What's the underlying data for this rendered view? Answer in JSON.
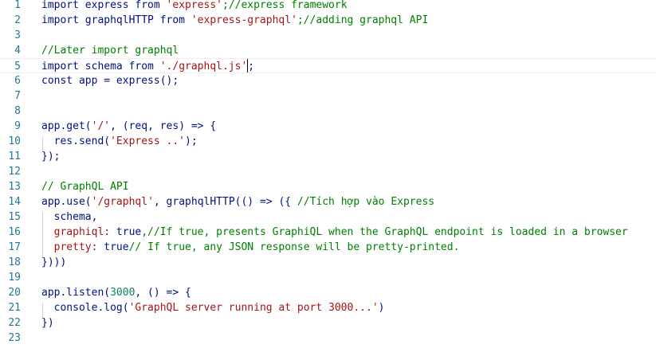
{
  "colors": {
    "keyword": "#0000ff",
    "identifier": "#001080",
    "string": "#a31515",
    "comment": "#008000",
    "number": "#098658",
    "line_number": "#237893",
    "function": "#795e26"
  },
  "editor": {
    "line_numbers": [
      "1",
      "2",
      "3",
      "4",
      "5",
      "6",
      "7",
      "8",
      "9",
      "10",
      "11",
      "12",
      "13",
      "14",
      "15",
      "16",
      "17",
      "18",
      "19",
      "20",
      "21",
      "22",
      "23"
    ],
    "lines": [
      [
        {
          "t": "import express from ",
          "c": "keyword"
        },
        {
          "t": "'express'",
          "c": "string"
        },
        {
          "t": ";//express framework",
          "c": "comment"
        }
      ],
      [
        {
          "t": "import graphqlHTTP from ",
          "c": "keyword"
        },
        {
          "t": "'express-graphql'",
          "c": "string"
        },
        {
          "t": ";//adding graphql API",
          "c": "comment"
        }
      ],
      [],
      [
        {
          "t": "//Later import graphql",
          "c": "comment"
        }
      ],
      [
        {
          "t": "import schema from ",
          "c": "keyword"
        },
        {
          "t": "'./graphql.js'",
          "c": "string"
        },
        {
          "t": "|",
          "c": "cursor"
        },
        {
          "t": ";",
          "c": "keyword"
        }
      ],
      [
        {
          "t": "const app = express();",
          "c": "keyword"
        }
      ],
      [],
      [],
      [
        {
          "t": "app.get(",
          "c": "keyword"
        },
        {
          "t": "'/'",
          "c": "string"
        },
        {
          "t": ", (req, res) => {",
          "c": "keyword"
        }
      ],
      [
        {
          "t": "  res.send(",
          "c": "keyword"
        },
        {
          "t": "'Express ..'",
          "c": "string"
        },
        {
          "t": ");",
          "c": "keyword"
        }
      ],
      [
        {
          "t": "});",
          "c": "keyword"
        }
      ],
      [],
      [
        {
          "t": "// GraphQL API",
          "c": "comment"
        }
      ],
      [
        {
          "t": "app.use(",
          "c": "keyword"
        },
        {
          "t": "'/graphql'",
          "c": "string"
        },
        {
          "t": ", graphqlHTTP(() => ({ ",
          "c": "keyword"
        },
        {
          "t": "//Tích hợp vào Express",
          "c": "comment"
        }
      ],
      [
        {
          "t": "  schema,",
          "c": "keyword"
        }
      ],
      [
        {
          "t": "  graphiql: ",
          "c": "string"
        },
        {
          "t": "true",
          "c": "keyword"
        },
        {
          "t": ",//If true, presents GraphiQL when the GraphQL endpoint is loaded in a browser",
          "c": "comment"
        }
      ],
      [
        {
          "t": "  pretty: ",
          "c": "string"
        },
        {
          "t": "true",
          "c": "keyword"
        },
        {
          "t": "// If true, any JSON response will be pretty-printed.",
          "c": "comment"
        }
      ],
      [
        {
          "t": "})))",
          "c": "keyword"
        }
      ],
      [],
      [
        {
          "t": "app.listen(",
          "c": "keyword"
        },
        {
          "t": "3000",
          "c": "number"
        },
        {
          "t": ", () => {",
          "c": "keyword"
        }
      ],
      [
        {
          "t": "  console.log(",
          "c": "keyword"
        },
        {
          "t": "'GraphQL server running at port 3000...'",
          "c": "string"
        },
        {
          "t": ")",
          "c": "keyword"
        }
      ],
      [
        {
          "t": "})",
          "c": "keyword"
        }
      ],
      []
    ]
  }
}
